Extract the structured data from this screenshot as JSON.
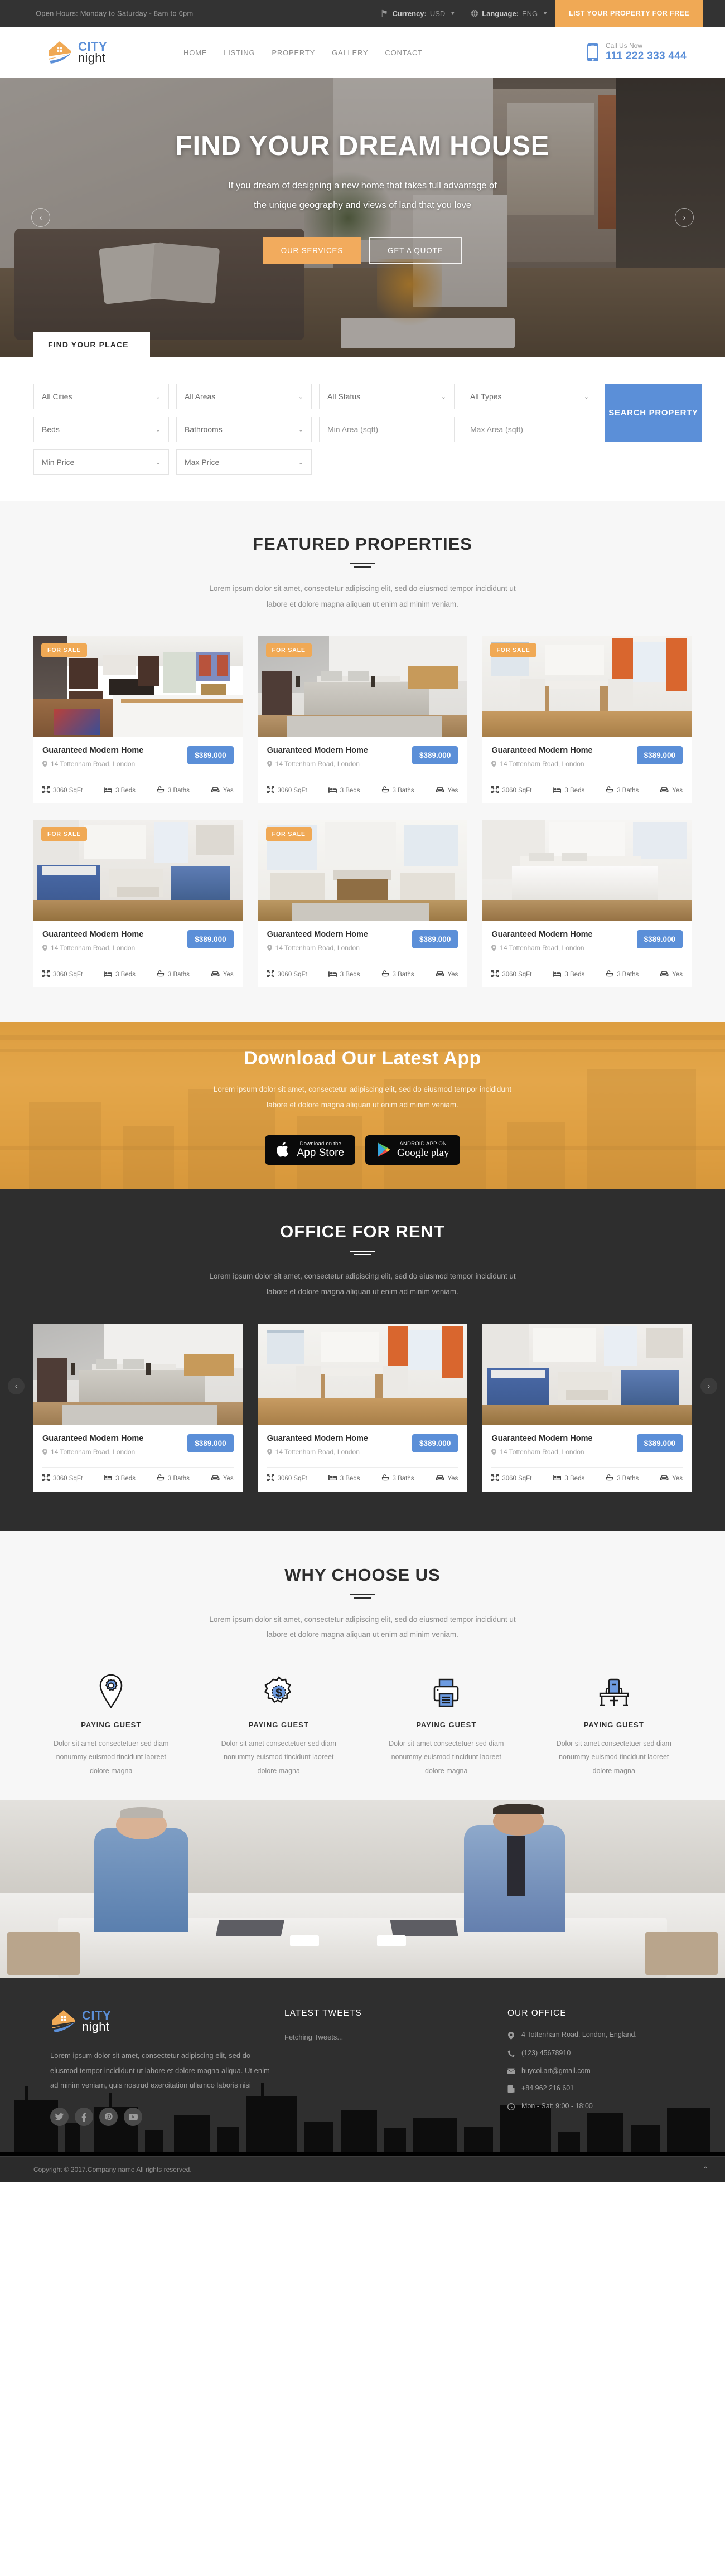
{
  "topbar": {
    "hours": "Open Hours: Monday to Saturday - 8am to 6pm",
    "currency_label": "Currency:",
    "currency_value": "USD",
    "language_label": "Language:",
    "language_value": "ENG",
    "cta": "LIST YOUR PROPERTY FOR FREE"
  },
  "header": {
    "logo_city": "CITY",
    "logo_night": "night",
    "nav": [
      "HOME",
      "LISTING",
      "PROPERTY",
      "GALLERY",
      "CONTACT"
    ],
    "call_label": "Call Us Now",
    "call_number": "111 222 333 444"
  },
  "hero": {
    "title": "FIND YOUR DREAM HOUSE",
    "subtitle_line1": "If you dream of designing a new home that takes full advantage of",
    "subtitle_line2": "the unique geography and views of land that you love",
    "btn_primary": "OUR SERVICES",
    "btn_secondary": "GET A QUOTE",
    "prev": "‹",
    "next": "›"
  },
  "search": {
    "tab_label": "FIND YOUR PLACE",
    "fields": [
      {
        "type": "select",
        "label": "All Cities"
      },
      {
        "type": "select",
        "label": "All Areas"
      },
      {
        "type": "select",
        "label": "All Status"
      },
      {
        "type": "select",
        "label": "All Types"
      },
      {
        "type": "select",
        "label": "Beds"
      },
      {
        "type": "select",
        "label": "Bathrooms"
      },
      {
        "type": "input",
        "label": "Min Area (sqft)"
      },
      {
        "type": "input",
        "label": "Max Area (sqft)"
      },
      {
        "type": "select",
        "label": "Min Price"
      },
      {
        "type": "select",
        "label": "Max Price"
      }
    ],
    "button": "SEARCH PROPERTY"
  },
  "featured": {
    "title": "FEATURED PROPERTIES",
    "desc_line1": "Lorem ipsum dolor sit amet, consectetur adipiscing elit, sed do eiusmod tempor incididunt ut",
    "desc_line2": "labore et dolore magna aliquan ut enim ad minim veniam.",
    "cards": [
      {
        "badge": "FOR SALE",
        "name": "Guaranteed Modern Home",
        "address": "14 Tottenham Road, London",
        "price": "$389.000",
        "area": "3060 SqFt",
        "beds": "3 Beds",
        "baths": "3 Baths",
        "garage": "Yes",
        "photo": "kitchen"
      },
      {
        "badge": "FOR SALE",
        "name": "Guaranteed Modern Home",
        "address": "14 Tottenham Road, London",
        "price": "$389.000",
        "area": "3060 SqFt",
        "beds": "3 Beds",
        "baths": "3 Baths",
        "garage": "Yes",
        "photo": "bedroom-gray"
      },
      {
        "badge": "FOR SALE",
        "name": "Guaranteed Modern Home",
        "address": "14 Tottenham Road, London",
        "price": "$389.000",
        "area": "3060 SqFt",
        "beds": "3 Beds",
        "baths": "3 Baths",
        "garage": "Yes",
        "photo": "dining-orange"
      },
      {
        "badge": "FOR SALE",
        "name": "Guaranteed Modern Home",
        "address": "14 Tottenham Road, London",
        "price": "$389.000",
        "area": "3060 SqFt",
        "beds": "3 Beds",
        "baths": "3 Baths",
        "garage": "Yes",
        "photo": "living-blue"
      },
      {
        "badge": "FOR SALE",
        "name": "Guaranteed Modern Home",
        "address": "14 Tottenham Road, London",
        "price": "$389.000",
        "area": "3060 SqFt",
        "beds": "3 Beds",
        "baths": "3 Baths",
        "garage": "Yes",
        "photo": "sunroom"
      },
      {
        "badge": "",
        "name": "Guaranteed Modern Home",
        "address": "14 Tottenham Road, London",
        "price": "$389.000",
        "area": "3060 SqFt",
        "beds": "3 Beds",
        "baths": "3 Baths",
        "garage": "Yes",
        "photo": "bedroom-white"
      }
    ]
  },
  "app": {
    "title": "Download Our Latest App",
    "desc_line1": "Lorem ipsum dolor sit amet, consectetur adipiscing elit, sed do eiusmod tempor incididunt",
    "desc_line2": "labore et dolore magna aliquan ut enim ad minim veniam.",
    "appstore_sub": "Download on the",
    "appstore_main": "App Store",
    "googleplay_sub": "ANDROID APP ON",
    "googleplay_main": "Google play"
  },
  "office": {
    "title": "OFFICE FOR RENT",
    "desc_line1": "Lorem ipsum dolor sit amet, consectetur adipiscing elit, sed do eiusmod tempor incididunt ut",
    "desc_line2": "labore et dolore magna aliquan ut enim ad minim veniam.",
    "prev": "‹",
    "next": "›",
    "cards": [
      {
        "name": "Guaranteed Modern Home",
        "address": "14 Tottenham Road, London",
        "price": "$389.000",
        "area": "3060 SqFt",
        "beds": "3 Beds",
        "baths": "3 Baths",
        "garage": "Yes",
        "photo": "bedroom-gray"
      },
      {
        "name": "Guaranteed Modern Home",
        "address": "14 Tottenham Road, London",
        "price": "$389.000",
        "area": "3060 SqFt",
        "beds": "3 Beds",
        "baths": "3 Baths",
        "garage": "Yes",
        "photo": "dining-orange"
      },
      {
        "name": "Guaranteed Modern Home",
        "address": "14 Tottenham Road, London",
        "price": "$389.000",
        "area": "3060 SqFt",
        "beds": "3 Beds",
        "baths": "3 Baths",
        "garage": "Yes",
        "photo": "living-blue"
      }
    ]
  },
  "why": {
    "title": "WHY CHOOSE US",
    "desc_line1": "Lorem ipsum dolor sit amet, consectetur adipiscing elit, sed do eiusmod tempor incididunt ut",
    "desc_line2": "labore et dolore magna aliquan ut enim ad minim veniam.",
    "items": [
      {
        "icon": "map-pin-gear-icon",
        "title": "PAYING GUEST",
        "text": "Dolor sit amet consectetuer sed diam nonummy euismod tincidunt laoreet dolore magna"
      },
      {
        "icon": "dollar-badge-icon",
        "title": "PAYING GUEST",
        "text": "Dolor sit amet consectetuer sed diam nonummy euismod tincidunt laoreet dolore magna"
      },
      {
        "icon": "printer-icon",
        "title": "PAYING GUEST",
        "text": "Dolor sit amet consectetuer sed diam nonummy euismod tincidunt laoreet dolore magna"
      },
      {
        "icon": "office-desk-icon",
        "title": "PAYING GUEST",
        "text": "Dolor sit amet consectetuer sed diam nonummy euismod tincidunt laoreet dolore magna"
      }
    ]
  },
  "footer": {
    "logo_city": "CITY",
    "logo_night": "night",
    "about": "Lorem ipsum dolor sit amet, consectetur adipiscing elit, sed do eiusmod tempor incididunt ut labore et dolore magna aliqua. Ut enim ad minim veniam, quis nostrud exercitation ullamco laboris nisi",
    "social": [
      "twitter-icon",
      "facebook-icon",
      "pinterest-icon",
      "youtube-icon"
    ],
    "tweets_title": "LATEST TWEETS",
    "tweets_status": "Fetching Tweets...",
    "office_title": "OUR OFFICE",
    "office_items": [
      {
        "icon": "location-pin-icon",
        "text": "4 Tottenham Road, London, England."
      },
      {
        "icon": "phone-icon",
        "text": "(123) 45678910"
      },
      {
        "icon": "envelope-icon",
        "text": "huycoi.art@gmail.com"
      },
      {
        "icon": "fax-icon",
        "text": "+84 962 216 601"
      },
      {
        "icon": "clock-icon",
        "text": "Mon - Sat: 9:00 - 18:00"
      }
    ],
    "copyright": "Copyright © 2017.Company name All rights reserved.",
    "to_top": "⌃"
  },
  "colors": {
    "accent_orange": "#f0a955",
    "accent_blue": "#5b8fd8",
    "dark": "#2e2e2e",
    "topbar": "#333333"
  }
}
